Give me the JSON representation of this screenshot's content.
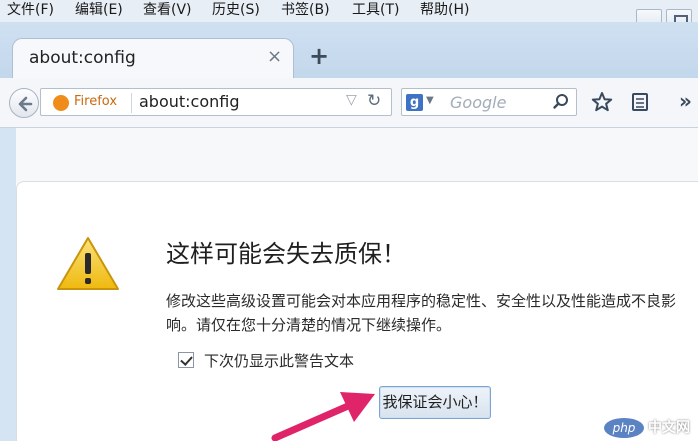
{
  "menu": {
    "items": [
      "文件(F)",
      "编辑(E)",
      "查看(V)",
      "历史(S)",
      "书签(B)",
      "工具(T)",
      "帮助(H)"
    ]
  },
  "tab": {
    "title": "about:config",
    "close": "×",
    "new_tab": "+"
  },
  "navbar": {
    "identity_label": "Firefox",
    "url": "about:config",
    "dropmarker": "▽",
    "reload": "↻",
    "search_engine": "g",
    "search_placeholder": "Google"
  },
  "warning": {
    "title": "这样可能会失去质保！",
    "body": "修改这些高级设置可能会对本应用程序的稳定性、安全性以及性能造成不良影响。请仅在您十分清楚的情况下继续操作。",
    "checkbox_label": "下次仍显示此警告文本",
    "checkbox_checked": true,
    "accept_button": "我保证会小心！"
  },
  "watermark": {
    "logo": "php",
    "text": "中文网"
  },
  "colors": {
    "accent": "#3e72c4",
    "warning_yellow": "#f3c320",
    "arrow": "#e0246a",
    "firefox_orange": "#f08c1a"
  }
}
